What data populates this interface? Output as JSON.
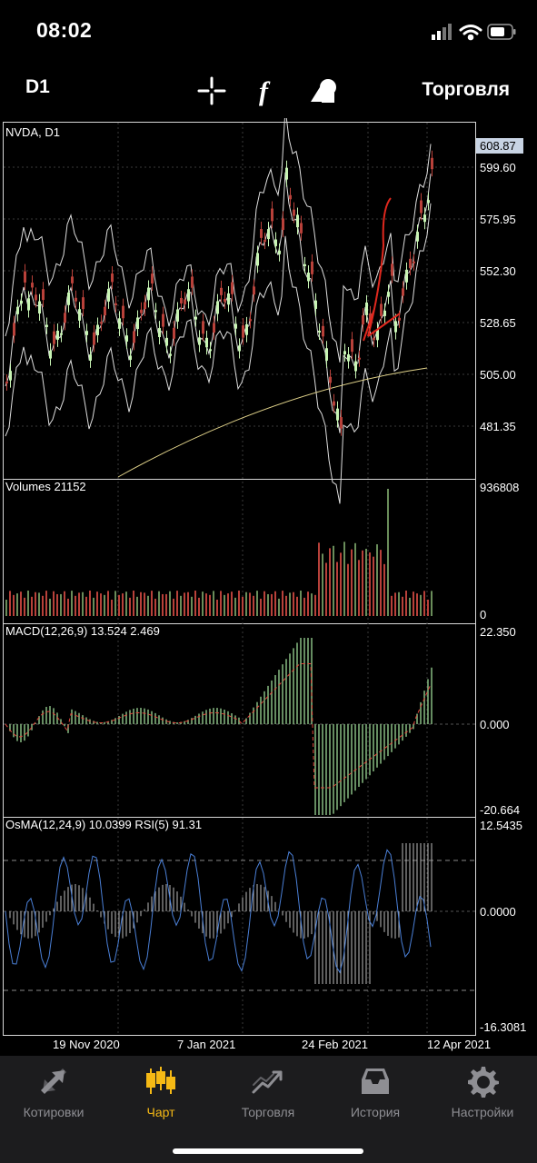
{
  "status": {
    "time": "08:02"
  },
  "toolbar": {
    "timeframe": "D1",
    "trade_label": "Торговля"
  },
  "colors": {
    "accent": "#f5b915",
    "bull": "#c8f5b4",
    "bear": "#b8413a",
    "macd_signal": "#e0463c",
    "rsi_line": "#4a7fd6",
    "ma200": "#e0d28a",
    "current_price_bg": "#c8d4e4"
  },
  "panels": {
    "price": {
      "title": "NVDA, D1",
      "current_price": "608.87",
      "axis_labels": [
        "599.60",
        "575.95",
        "552.30",
        "528.65",
        "505.00",
        "481.35"
      ]
    },
    "volume": {
      "title": "Volumes 21152",
      "axis_max": "936808",
      "axis_min": "0"
    },
    "macd": {
      "title": "MACD(12,26,9) 13.524 2.469",
      "axis_top": "22.350",
      "axis_mid": "0.000",
      "axis_bottom": "-20.664"
    },
    "osma": {
      "title": "OsMA(12,24,9) 10.0399 RSI(5) 91.31",
      "axis_top": "12.5435",
      "axis_mid": "0.0000",
      "axis_bottom": "-16.3081"
    }
  },
  "time_axis": [
    "19 Nov 2020",
    "7 Jan 2021",
    "24 Feb 2021",
    "12 Apr 2021"
  ],
  "nav": [
    {
      "label": "Котировки",
      "icon": "quotes-icon",
      "active": false
    },
    {
      "label": "Чарт",
      "icon": "chart-icon",
      "active": true
    },
    {
      "label": "Торговля",
      "icon": "trade-icon",
      "active": false
    },
    {
      "label": "История",
      "icon": "history-icon",
      "active": false
    },
    {
      "label": "Настройки",
      "icon": "settings-icon",
      "active": false
    }
  ]
}
